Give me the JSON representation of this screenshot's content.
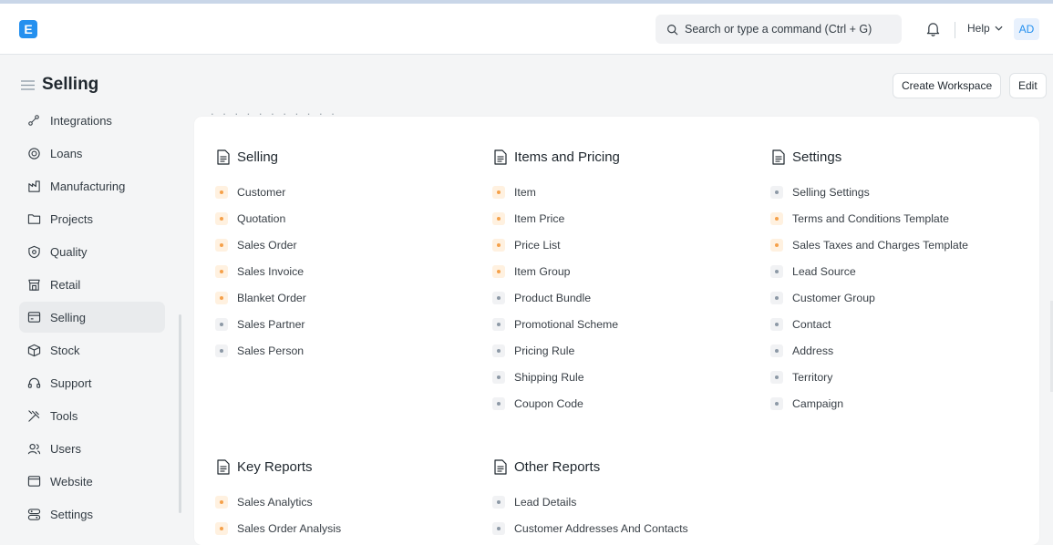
{
  "navbar": {
    "logo_letter": "E",
    "search_placeholder": "Search or type a command (Ctrl + G)",
    "help_label": "Help",
    "avatar_initials": "AD"
  },
  "page": {
    "title": "Selling",
    "create_workspace_label": "Create Workspace",
    "edit_label": "Edit"
  },
  "sidebar": {
    "items": [
      {
        "label": "Integrations",
        "icon": "integrations-icon"
      },
      {
        "label": "Loans",
        "icon": "loans-icon"
      },
      {
        "label": "Manufacturing",
        "icon": "manufacturing-icon"
      },
      {
        "label": "Projects",
        "icon": "folder-icon"
      },
      {
        "label": "Quality",
        "icon": "quality-icon"
      },
      {
        "label": "Retail",
        "icon": "retail-icon"
      },
      {
        "label": "Selling",
        "icon": "selling-icon",
        "active": true
      },
      {
        "label": "Stock",
        "icon": "stock-icon"
      },
      {
        "label": "Support",
        "icon": "support-icon"
      },
      {
        "label": "Tools",
        "icon": "tools-icon"
      },
      {
        "label": "Users",
        "icon": "users-icon"
      },
      {
        "label": "Website",
        "icon": "website-icon"
      },
      {
        "label": "Settings",
        "icon": "settings-icon"
      }
    ]
  },
  "sections": {
    "selling": {
      "title": "Selling",
      "links": [
        {
          "label": "Customer",
          "accent": "orange"
        },
        {
          "label": "Quotation",
          "accent": "orange"
        },
        {
          "label": "Sales Order",
          "accent": "orange"
        },
        {
          "label": "Sales Invoice",
          "accent": "orange"
        },
        {
          "label": "Blanket Order",
          "accent": "orange"
        },
        {
          "label": "Sales Partner",
          "accent": "gray"
        },
        {
          "label": "Sales Person",
          "accent": "gray"
        }
      ]
    },
    "items_pricing": {
      "title": "Items and Pricing",
      "links": [
        {
          "label": "Item",
          "accent": "orange"
        },
        {
          "label": "Item Price",
          "accent": "orange"
        },
        {
          "label": "Price List",
          "accent": "orange"
        },
        {
          "label": "Item Group",
          "accent": "orange"
        },
        {
          "label": "Product Bundle",
          "accent": "gray"
        },
        {
          "label": "Promotional Scheme",
          "accent": "gray"
        },
        {
          "label": "Pricing Rule",
          "accent": "gray"
        },
        {
          "label": "Shipping Rule",
          "accent": "gray"
        },
        {
          "label": "Coupon Code",
          "accent": "gray"
        }
      ]
    },
    "settings": {
      "title": "Settings",
      "links": [
        {
          "label": "Selling Settings",
          "accent": "gray"
        },
        {
          "label": "Terms and Conditions Template",
          "accent": "orange"
        },
        {
          "label": "Sales Taxes and Charges Template",
          "accent": "orange"
        },
        {
          "label": "Lead Source",
          "accent": "gray"
        },
        {
          "label": "Customer Group",
          "accent": "gray"
        },
        {
          "label": "Contact",
          "accent": "gray"
        },
        {
          "label": "Address",
          "accent": "gray"
        },
        {
          "label": "Territory",
          "accent": "gray"
        },
        {
          "label": "Campaign",
          "accent": "gray"
        }
      ]
    },
    "key_reports": {
      "title": "Key Reports",
      "links": [
        {
          "label": "Sales Analytics",
          "accent": "orange"
        },
        {
          "label": "Sales Order Analysis",
          "accent": "orange"
        }
      ]
    },
    "other_reports": {
      "title": "Other Reports",
      "links": [
        {
          "label": "Lead Details",
          "accent": "gray"
        },
        {
          "label": "Customer Addresses And Contacts",
          "accent": "gray"
        }
      ]
    }
  },
  "colors": {
    "accent_blue": "#2490ef",
    "orange_dot": "#f5a14a",
    "gray_dot": "#8d99a6",
    "active_bg": "#e9ebed"
  }
}
